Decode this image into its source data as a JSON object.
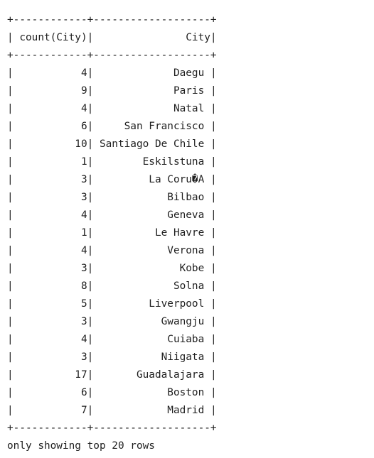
{
  "table": {
    "headers": [
      "count(City)",
      "City"
    ],
    "rows": [
      {
        "count": "4",
        "city": "Daegu"
      },
      {
        "count": "9",
        "city": "Paris"
      },
      {
        "count": "4",
        "city": "Natal"
      },
      {
        "count": "6",
        "city": "San Francisco"
      },
      {
        "count": "10",
        "city": "Santiago De Chile"
      },
      {
        "count": "1",
        "city": "Eskilstuna"
      },
      {
        "count": "3",
        "city": "La Coru�A"
      },
      {
        "count": "3",
        "city": "Bilbao"
      },
      {
        "count": "4",
        "city": "Geneva"
      },
      {
        "count": "1",
        "city": "Le Havre"
      },
      {
        "count": "4",
        "city": "Verona"
      },
      {
        "count": "3",
        "city": "Kobe"
      },
      {
        "count": "8",
        "city": "Solna"
      },
      {
        "count": "5",
        "city": "Liverpool"
      },
      {
        "count": "3",
        "city": "Gwangju"
      },
      {
        "count": "4",
        "city": "Cuiaba"
      },
      {
        "count": "3",
        "city": "Niigata"
      },
      {
        "count": "17",
        "city": "Guadalajara"
      },
      {
        "count": "6",
        "city": "Boston"
      },
      {
        "count": "7",
        "city": "Madrid"
      }
    ]
  },
  "footer": {
    "message": "only showing top 20 rows"
  }
}
